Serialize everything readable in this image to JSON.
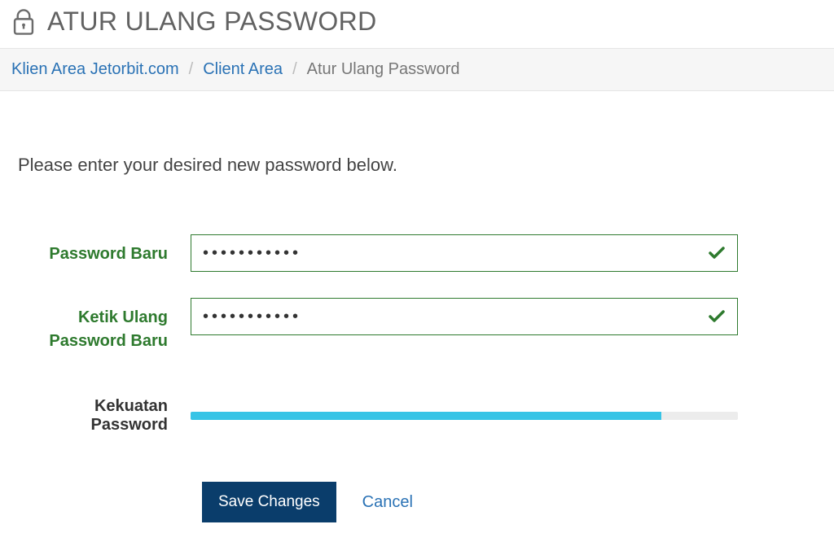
{
  "header": {
    "title": "ATUR ULANG PASSWORD"
  },
  "breadcrumb": {
    "items": [
      {
        "label": "Klien Area Jetorbit.com",
        "link": true
      },
      {
        "label": "Client Area",
        "link": true
      },
      {
        "label": "Atur Ulang Password",
        "link": false
      }
    ],
    "separator": "/"
  },
  "content": {
    "intro": "Please enter your desired new password below."
  },
  "form": {
    "new_password": {
      "label": "Password Baru",
      "value": "•••••••••••",
      "valid": true
    },
    "confirm_password": {
      "label": "Ketik Ulang Password Baru",
      "value": "•••••••••••",
      "valid": true
    },
    "strength": {
      "label": "Kekuatan Password",
      "percent": 86
    }
  },
  "actions": {
    "save": "Save Changes",
    "cancel": "Cancel"
  },
  "colors": {
    "success_border": "#2e7a2e",
    "link": "#2a72b5",
    "primary_btn": "#0a3d6b",
    "strength_fill": "#37c4e6"
  }
}
